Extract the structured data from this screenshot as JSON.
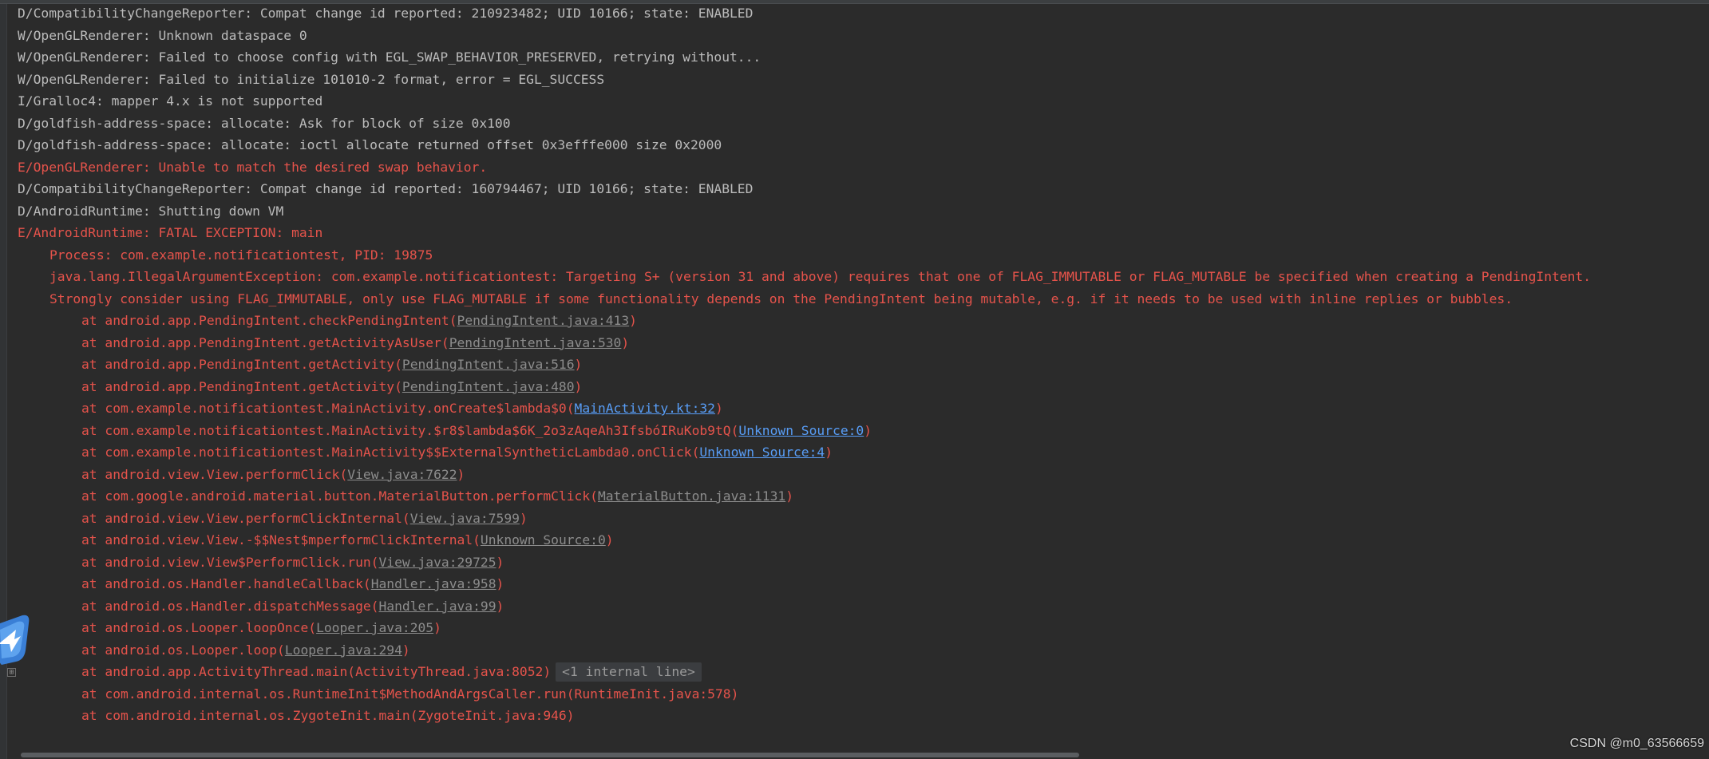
{
  "log_lines": [
    {
      "level": "D",
      "indent": 0,
      "segments": [
        {
          "t": "D/CompatibilityChangeReporter: Compat change id reported: 210923482; UID 10166; state: ENABLED"
        }
      ]
    },
    {
      "level": "W",
      "indent": 0,
      "segments": [
        {
          "t": "W/OpenGLRenderer: Unknown dataspace 0"
        }
      ]
    },
    {
      "level": "W",
      "indent": 0,
      "segments": [
        {
          "t": "W/OpenGLRenderer: Failed to choose config with EGL_SWAP_BEHAVIOR_PRESERVED, retrying without..."
        }
      ]
    },
    {
      "level": "W",
      "indent": 0,
      "segments": [
        {
          "t": "W/OpenGLRenderer: Failed to initialize 101010-2 format, error = EGL_SUCCESS"
        }
      ]
    },
    {
      "level": "I",
      "indent": 0,
      "segments": [
        {
          "t": "I/Gralloc4: mapper 4.x is not supported"
        }
      ]
    },
    {
      "level": "D",
      "indent": 0,
      "segments": [
        {
          "t": "D/goldfish-address-space: allocate: Ask for block of size 0x100"
        }
      ]
    },
    {
      "level": "D",
      "indent": 0,
      "segments": [
        {
          "t": "D/goldfish-address-space: allocate: ioctl allocate returned offset 0x3efffe000 size 0x2000"
        }
      ]
    },
    {
      "level": "E",
      "indent": 0,
      "segments": [
        {
          "t": "E/OpenGLRenderer: Unable to match the desired swap behavior."
        }
      ]
    },
    {
      "level": "D",
      "indent": 0,
      "segments": [
        {
          "t": "D/CompatibilityChangeReporter: Compat change id reported: 160794467; UID 10166; state: ENABLED"
        }
      ]
    },
    {
      "level": "D",
      "indent": 0,
      "segments": [
        {
          "t": "D/AndroidRuntime: Shutting down VM"
        }
      ]
    },
    {
      "level": "E",
      "indent": 0,
      "segments": [
        {
          "t": "E/AndroidRuntime: FATAL EXCEPTION: main"
        }
      ]
    },
    {
      "level": "E",
      "indent": 1,
      "segments": [
        {
          "t": "Process: com.example.notificationtest, PID: 19875"
        }
      ]
    },
    {
      "level": "E",
      "indent": 1,
      "segments": [
        {
          "t": "java.lang.IllegalArgumentException: com.example.notificationtest: Targeting S+ (version 31 and above) requires that one of FLAG_IMMUTABLE or FLAG_MUTABLE be specified when creating a PendingIntent."
        }
      ]
    },
    {
      "level": "E",
      "indent": 1,
      "segments": [
        {
          "t": "Strongly consider using FLAG_IMMUTABLE, only use FLAG_MUTABLE if some functionality depends on the PendingIntent being mutable, e.g. if it needs to be used with inline replies or bubbles."
        }
      ]
    },
    {
      "level": "E",
      "indent": 2,
      "segments": [
        {
          "t": "at android.app.PendingIntent.checkPendingIntent("
        },
        {
          "t": "PendingIntent.java:413",
          "link": "gray"
        },
        {
          "t": ")"
        }
      ]
    },
    {
      "level": "E",
      "indent": 2,
      "segments": [
        {
          "t": "at android.app.PendingIntent.getActivityAsUser("
        },
        {
          "t": "PendingIntent.java:530",
          "link": "gray"
        },
        {
          "t": ")"
        }
      ]
    },
    {
      "level": "E",
      "indent": 2,
      "segments": [
        {
          "t": "at android.app.PendingIntent.getActivity("
        },
        {
          "t": "PendingIntent.java:516",
          "link": "gray"
        },
        {
          "t": ")"
        }
      ]
    },
    {
      "level": "E",
      "indent": 2,
      "segments": [
        {
          "t": "at android.app.PendingIntent.getActivity("
        },
        {
          "t": "PendingIntent.java:480",
          "link": "gray"
        },
        {
          "t": ")"
        }
      ]
    },
    {
      "level": "E",
      "indent": 2,
      "segments": [
        {
          "t": "at com.example.notificationtest.MainActivity.onCreate$lambda$0("
        },
        {
          "t": "MainActivity.kt:32",
          "link": "blue"
        },
        {
          "t": ")"
        }
      ]
    },
    {
      "level": "E",
      "indent": 2,
      "segments": [
        {
          "t": "at com.example.notificationtest.MainActivity.$r8$lambda$6K_2o3zAqeAh3IfsbóIRuKob9tQ("
        },
        {
          "t": "Unknown Source:0",
          "link": "blue"
        },
        {
          "t": ")"
        }
      ]
    },
    {
      "level": "E",
      "indent": 2,
      "segments": [
        {
          "t": "at com.example.notificationtest.MainActivity$$ExternalSyntheticLambda0.onClick("
        },
        {
          "t": "Unknown Source:4",
          "link": "blue"
        },
        {
          "t": ")"
        }
      ]
    },
    {
      "level": "E",
      "indent": 2,
      "segments": [
        {
          "t": "at android.view.View.performClick("
        },
        {
          "t": "View.java:7622",
          "link": "gray"
        },
        {
          "t": ")"
        }
      ]
    },
    {
      "level": "E",
      "indent": 2,
      "segments": [
        {
          "t": "at com.google.android.material.button.MaterialButton.performClick("
        },
        {
          "t": "MaterialButton.java:1131",
          "link": "gray"
        },
        {
          "t": ")"
        }
      ]
    },
    {
      "level": "E",
      "indent": 2,
      "segments": [
        {
          "t": "at android.view.View.performClickInternal("
        },
        {
          "t": "View.java:7599",
          "link": "gray"
        },
        {
          "t": ")"
        }
      ]
    },
    {
      "level": "E",
      "indent": 2,
      "segments": [
        {
          "t": "at android.view.View.-$$Nest$mperformClickInternal("
        },
        {
          "t": "Unknown Source:0",
          "link": "gray"
        },
        {
          "t": ")"
        }
      ]
    },
    {
      "level": "E",
      "indent": 2,
      "segments": [
        {
          "t": "at android.view.View$PerformClick.run("
        },
        {
          "t": "View.java:29725",
          "link": "gray"
        },
        {
          "t": ")"
        }
      ]
    },
    {
      "level": "E",
      "indent": 2,
      "segments": [
        {
          "t": "at android.os.Handler.handleCallback("
        },
        {
          "t": "Handler.java:958",
          "link": "gray"
        },
        {
          "t": ")"
        }
      ]
    },
    {
      "level": "E",
      "indent": 2,
      "segments": [
        {
          "t": "at android.os.Handler.dispatchMessage("
        },
        {
          "t": "Handler.java:99",
          "link": "gray"
        },
        {
          "t": ")"
        }
      ]
    },
    {
      "level": "E",
      "indent": 2,
      "segments": [
        {
          "t": "at android.os.Looper.loopOnce("
        },
        {
          "t": "Looper.java:205",
          "link": "gray"
        },
        {
          "t": ")"
        }
      ]
    },
    {
      "level": "E",
      "indent": 2,
      "segments": [
        {
          "t": "at android.os.Looper.loop("
        },
        {
          "t": "Looper.java:294",
          "link": "gray"
        },
        {
          "t": ")"
        }
      ]
    },
    {
      "level": "E",
      "indent": 2,
      "segments": [
        {
          "t": "at android.app.ActivityThread.main(ActivityThread.java:8052)"
        }
      ],
      "fold_chip": "<1 internal line>"
    },
    {
      "level": "E",
      "indent": 2,
      "segments": [
        {
          "t": "at com.android.internal.os.RuntimeInit$MethodAndArgsCaller.run(RuntimeInit.java:578)"
        }
      ]
    },
    {
      "level": "E",
      "indent": 2,
      "segments": [
        {
          "t": "at com.android.internal.os.ZygoteInit.main(ZygoteInit.java:946)"
        }
      ]
    }
  ],
  "fold_marker": "⊞",
  "watermark": "CSDN @m0_63566659",
  "colors": {
    "background": "#2b2b2b",
    "text_normal": "#bbbbbb",
    "text_error": "#e5534b",
    "link_blue": "#589df6",
    "link_gray": "#8c8c8c"
  },
  "icons": {
    "floating": "bird-icon"
  }
}
